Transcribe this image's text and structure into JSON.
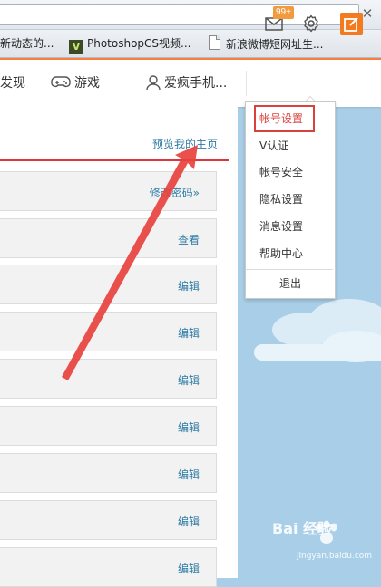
{
  "bookmarks": [
    {
      "label": "新动态的..."
    },
    {
      "label": "PhotoshopCS视频..."
    },
    {
      "label": "新浪微博短网址生..."
    }
  ],
  "nav": {
    "discover": "发现",
    "games": "游戏",
    "user": "爱疯手机...",
    "mail_badge": "99+"
  },
  "panel": {
    "preview_link": "预览我的主页",
    "rows": [
      {
        "action": "修改密码»"
      },
      {
        "action": "查看"
      },
      {
        "action": "编辑"
      },
      {
        "action": "编辑"
      },
      {
        "action": "编辑"
      },
      {
        "action": "编辑"
      },
      {
        "action": "编辑"
      },
      {
        "action": "编辑"
      },
      {
        "action": "编辑"
      }
    ]
  },
  "dropdown": {
    "items": [
      "帐号设置",
      "V认证",
      "帐号安全",
      "隐私设置",
      "消息设置",
      "帮助中心"
    ],
    "logout": "退出"
  },
  "colors": {
    "accent_orange": "#fa7d3c",
    "link_blue": "#2d7ba5",
    "highlight_red": "#d9423c",
    "annotation_red": "#e8423e"
  },
  "watermark": {
    "text": "Bai 经验",
    "url": "jingyan.baidu.com"
  }
}
